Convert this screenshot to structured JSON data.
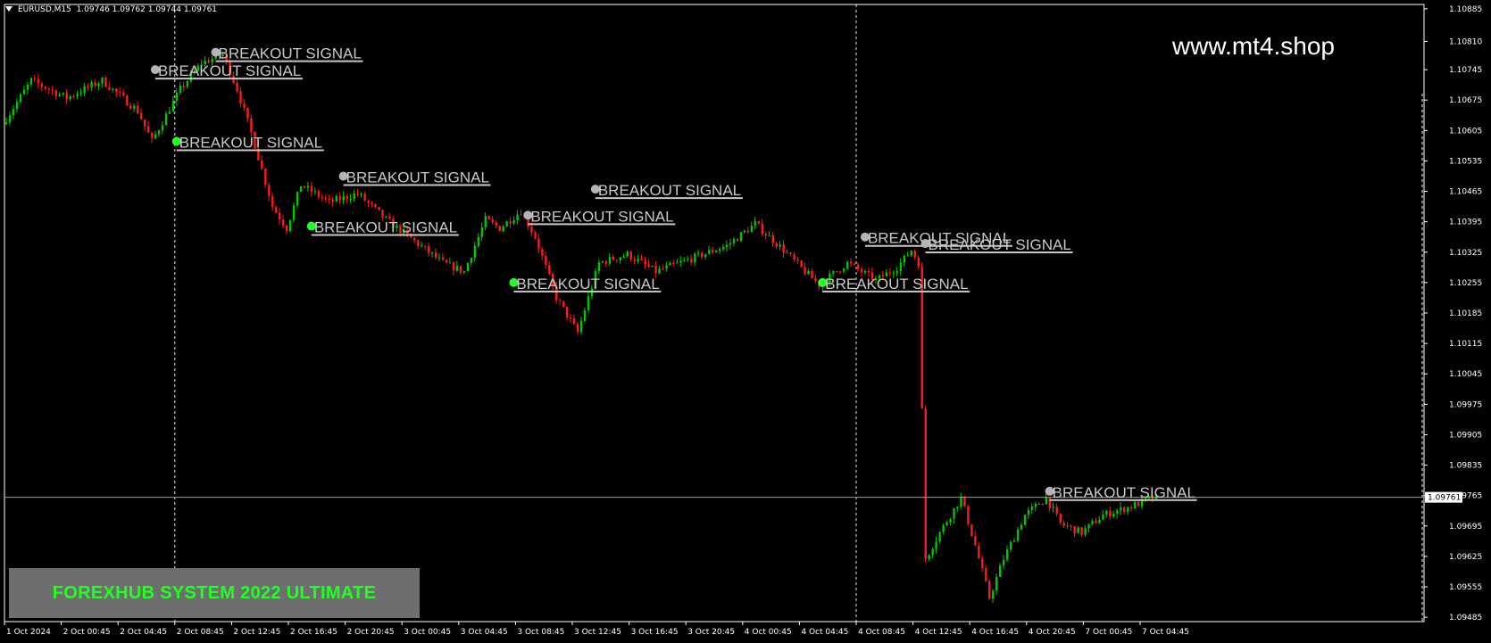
{
  "header": {
    "symbol": "EURUSD,M15",
    "ohlc": "1.09746 1.09762 1.09744 1.09761"
  },
  "watermark": "www.mt4.shop",
  "system_label": "FOREXHUB SYSTEM 2022 ULTIMATE",
  "colors": {
    "background": "#000000",
    "bull": "#00c800",
    "bear": "#ff1a1a",
    "signal_text": "#c8c8c8",
    "signal_dot": "#22ff22",
    "grid": "#ffffff",
    "system_box": "#6e6e6e",
    "system_text": "#22ff22"
  },
  "chart_data": {
    "type": "candlestick",
    "price_ticks": [
      "1.10885",
      "1.10810",
      "1.10745",
      "1.10675",
      "1.10605",
      "1.10535",
      "1.10465",
      "1.10395",
      "1.10325",
      "1.10255",
      "1.10185",
      "1.10115",
      "1.10045",
      "1.09975",
      "1.09905",
      "1.09835",
      "1.09765",
      "1.09695",
      "1.09625",
      "1.09555",
      "1.09485"
    ],
    "current_price": "1.09761",
    "ylim": [
      1.09475,
      1.10895
    ],
    "time_labels": [
      "1 Oct 2024",
      "2 Oct 00:45",
      "2 Oct 04:45",
      "2 Oct 08:45",
      "2 Oct 12:45",
      "2 Oct 16:45",
      "2 Oct 20:45",
      "3 Oct 00:45",
      "3 Oct 04:45",
      "3 Oct 08:45",
      "3 Oct 12:45",
      "3 Oct 16:45",
      "3 Oct 20:45",
      "4 Oct 00:45",
      "4 Oct 04:45",
      "4 Oct 08:45",
      "4 Oct 12:45",
      "4 Oct 16:45",
      "4 Oct 20:45",
      "7 Oct 00:45",
      "7 Oct 04:45"
    ],
    "day_separators": [
      3,
      15,
      27,
      39,
      51,
      66
    ],
    "price_path": [
      [
        0,
        1.1062
      ],
      [
        8,
        1.1072
      ],
      [
        18,
        1.1068
      ],
      [
        28,
        1.1072
      ],
      [
        38,
        1.1065
      ],
      [
        42,
        1.1058
      ],
      [
        50,
        1.107
      ],
      [
        56,
        1.1076
      ],
      [
        62,
        1.1078
      ],
      [
        66,
        1.107
      ],
      [
        70,
        1.106
      ],
      [
        76,
        1.1043
      ],
      [
        80,
        1.1038
      ],
      [
        84,
        1.1048
      ],
      [
        92,
        1.1044
      ],
      [
        100,
        1.1046
      ],
      [
        108,
        1.104
      ],
      [
        116,
        1.1035
      ],
      [
        124,
        1.103
      ],
      [
        130,
        1.1028
      ],
      [
        136,
        1.104
      ],
      [
        140,
        1.1038
      ],
      [
        146,
        1.1042
      ],
      [
        150,
        1.1036
      ],
      [
        156,
        1.1022
      ],
      [
        162,
        1.1014
      ],
      [
        168,
        1.103
      ],
      [
        176,
        1.1032
      ],
      [
        184,
        1.1028
      ],
      [
        194,
        1.1031
      ],
      [
        204,
        1.1034
      ],
      [
        212,
        1.1039
      ],
      [
        220,
        1.1033
      ],
      [
        226,
        1.1028
      ],
      [
        230,
        1.1025
      ],
      [
        238,
        1.103
      ],
      [
        246,
        1.1026
      ],
      [
        252,
        1.1029
      ],
      [
        256,
        1.1033
      ],
      [
        258,
        1.103
      ],
      [
        260,
        1.0962
      ],
      [
        264,
        1.0968
      ],
      [
        270,
        1.0976
      ],
      [
        274,
        1.0965
      ],
      [
        278,
        1.0953
      ],
      [
        282,
        1.0962
      ],
      [
        288,
        1.0972
      ],
      [
        294,
        1.0976
      ],
      [
        298,
        1.097
      ],
      [
        304,
        1.0968
      ],
      [
        310,
        1.0972
      ],
      [
        318,
        1.0974
      ],
      [
        324,
        1.0976
      ]
    ],
    "signals": [
      {
        "text": "BREAKOUT SIGNAL",
        "index": 42,
        "price": 1.10745,
        "dot": "gray"
      },
      {
        "text": "BREAKOUT SIGNAL",
        "index": 59,
        "price": 1.10785,
        "dot": "gray"
      },
      {
        "text": "BREAKOUT SIGNAL",
        "index": 48,
        "price": 1.1058,
        "dot": "green"
      },
      {
        "text": "BREAKOUT SIGNAL",
        "index": 95,
        "price": 1.105,
        "dot": "gray"
      },
      {
        "text": "BREAKOUT SIGNAL",
        "index": 86,
        "price": 1.10385,
        "dot": "green"
      },
      {
        "text": "BREAKOUT SIGNAL",
        "index": 166,
        "price": 1.1047,
        "dot": "gray"
      },
      {
        "text": "BREAKOUT SIGNAL",
        "index": 147,
        "price": 1.1041,
        "dot": "gray"
      },
      {
        "text": "BREAKOUT SIGNAL",
        "index": 143,
        "price": 1.10255,
        "dot": "green"
      },
      {
        "text": "BREAKOUT SIGNAL",
        "index": 242,
        "price": 1.1036,
        "dot": "gray"
      },
      {
        "text": "BREAKOUT SIGNAL",
        "index": 259,
        "price": 1.10345,
        "dot": "gray"
      },
      {
        "text": "BREAKOUT SIGNAL",
        "index": 230,
        "price": 1.10255,
        "dot": "green"
      },
      {
        "text": "BREAKOUT SIGNAL",
        "index": 294,
        "price": 1.09775,
        "dot": "gray"
      }
    ]
  }
}
